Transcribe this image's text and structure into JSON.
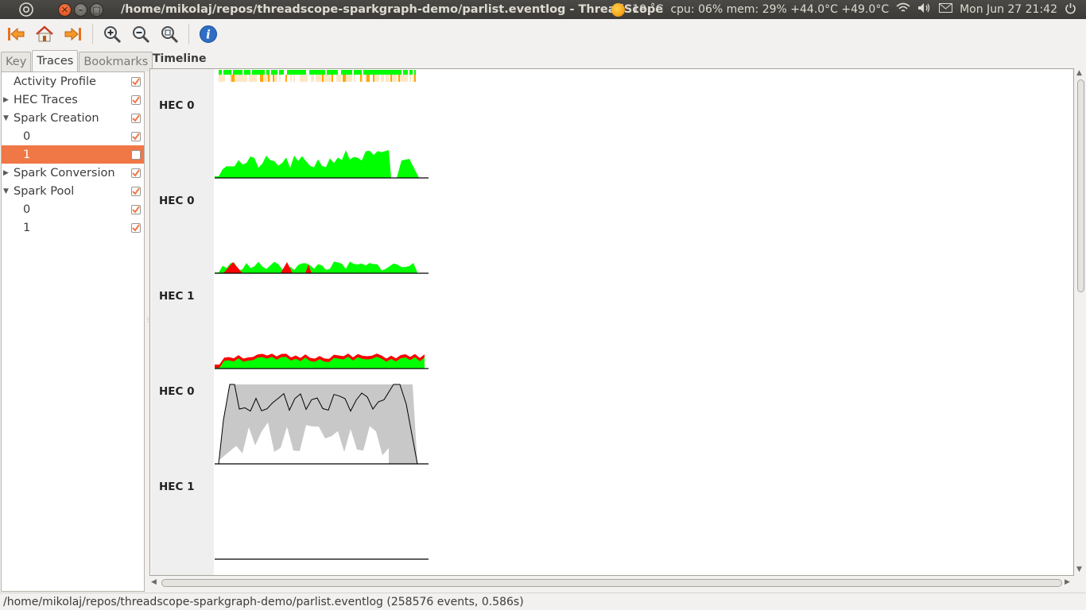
{
  "topbar": {
    "window_title": "/home/mikolaj/repos/threadscope-sparkgraph-demo/parlist.eventlog - ThreadScope",
    "weather": "19 ˚C",
    "system_monitor": "cpu: 06% mem: 29% +44.0°C +49.0°C",
    "datetime": "Mon Jun 27 21:42",
    "icons": [
      "ubuntu-logo-icon",
      "close-icon",
      "minimize-icon",
      "maximize-icon",
      "weather-sun-icon",
      "wifi-icon",
      "volume-icon",
      "mail-icon",
      "power-icon"
    ]
  },
  "toolbar": {
    "buttons": [
      "jump-to-start-icon",
      "home-icon",
      "jump-to-end-icon",
      "zoom-in-icon",
      "zoom-out-icon",
      "zoom-fit-icon",
      "info-icon"
    ]
  },
  "tabs": [
    {
      "label": "Key",
      "active": false
    },
    {
      "label": "Traces",
      "active": true
    },
    {
      "label": "Bookmarks",
      "active": false
    }
  ],
  "traces": [
    {
      "label": "Activity Profile",
      "level": 0,
      "expander": "",
      "checked": true,
      "selected": false
    },
    {
      "label": "HEC Traces",
      "level": 0,
      "expander": "collapsed",
      "checked": true,
      "selected": false
    },
    {
      "label": "Spark Creation",
      "level": 0,
      "expander": "expanded",
      "checked": true,
      "selected": false
    },
    {
      "label": "0",
      "level": 1,
      "expander": "",
      "checked": true,
      "selected": false
    },
    {
      "label": "1",
      "level": 1,
      "expander": "",
      "checked": false,
      "selected": true
    },
    {
      "label": "Spark Conversion",
      "level": 0,
      "expander": "collapsed",
      "checked": true,
      "selected": false
    },
    {
      "label": "Spark Pool",
      "level": 0,
      "expander": "expanded",
      "checked": true,
      "selected": false
    },
    {
      "label": "0",
      "level": 1,
      "expander": "",
      "checked": true,
      "selected": false
    },
    {
      "label": "1",
      "level": 1,
      "expander": "",
      "checked": true,
      "selected": false
    }
  ],
  "timeline": {
    "header": "Timeline",
    "rows": [
      "HEC 0",
      "HEC 0",
      "HEC 1",
      "HEC 0",
      "HEC 1"
    ]
  },
  "colors": {
    "accent_orange": "#f07746",
    "spark_green": "#00ff00",
    "spark_red": "#ff0000",
    "pool_gray": "#c8c8c8",
    "activity_orange": "#ffa500"
  },
  "statusbar": {
    "text": "/home/mikolaj/repos/threadscope-sparkgraph-demo/parlist.eventlog (258576 events, 0.586s)"
  }
}
